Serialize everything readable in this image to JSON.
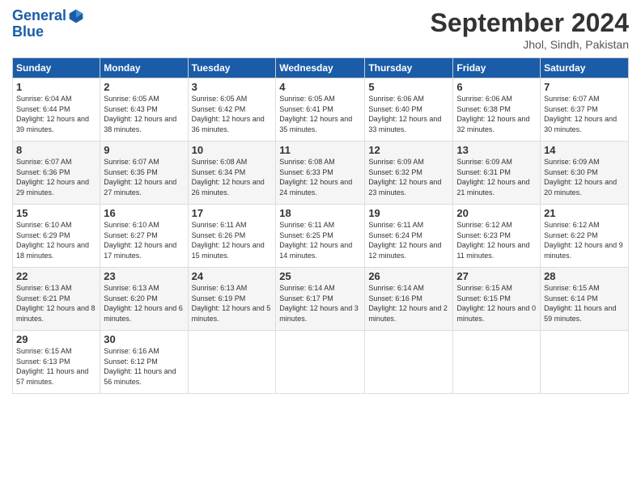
{
  "header": {
    "logo_line1": "General",
    "logo_line2": "Blue",
    "month_title": "September 2024",
    "location": "Jhol, Sindh, Pakistan"
  },
  "weekdays": [
    "Sunday",
    "Monday",
    "Tuesday",
    "Wednesday",
    "Thursday",
    "Friday",
    "Saturday"
  ],
  "weeks": [
    [
      {
        "day": "1",
        "sunrise": "6:04 AM",
        "sunset": "6:44 PM",
        "daylight": "12 hours and 39 minutes."
      },
      {
        "day": "2",
        "sunrise": "6:05 AM",
        "sunset": "6:43 PM",
        "daylight": "12 hours and 38 minutes."
      },
      {
        "day": "3",
        "sunrise": "6:05 AM",
        "sunset": "6:42 PM",
        "daylight": "12 hours and 36 minutes."
      },
      {
        "day": "4",
        "sunrise": "6:05 AM",
        "sunset": "6:41 PM",
        "daylight": "12 hours and 35 minutes."
      },
      {
        "day": "5",
        "sunrise": "6:06 AM",
        "sunset": "6:40 PM",
        "daylight": "12 hours and 33 minutes."
      },
      {
        "day": "6",
        "sunrise": "6:06 AM",
        "sunset": "6:38 PM",
        "daylight": "12 hours and 32 minutes."
      },
      {
        "day": "7",
        "sunrise": "6:07 AM",
        "sunset": "6:37 PM",
        "daylight": "12 hours and 30 minutes."
      }
    ],
    [
      {
        "day": "8",
        "sunrise": "6:07 AM",
        "sunset": "6:36 PM",
        "daylight": "12 hours and 29 minutes."
      },
      {
        "day": "9",
        "sunrise": "6:07 AM",
        "sunset": "6:35 PM",
        "daylight": "12 hours and 27 minutes."
      },
      {
        "day": "10",
        "sunrise": "6:08 AM",
        "sunset": "6:34 PM",
        "daylight": "12 hours and 26 minutes."
      },
      {
        "day": "11",
        "sunrise": "6:08 AM",
        "sunset": "6:33 PM",
        "daylight": "12 hours and 24 minutes."
      },
      {
        "day": "12",
        "sunrise": "6:09 AM",
        "sunset": "6:32 PM",
        "daylight": "12 hours and 23 minutes."
      },
      {
        "day": "13",
        "sunrise": "6:09 AM",
        "sunset": "6:31 PM",
        "daylight": "12 hours and 21 minutes."
      },
      {
        "day": "14",
        "sunrise": "6:09 AM",
        "sunset": "6:30 PM",
        "daylight": "12 hours and 20 minutes."
      }
    ],
    [
      {
        "day": "15",
        "sunrise": "6:10 AM",
        "sunset": "6:29 PM",
        "daylight": "12 hours and 18 minutes."
      },
      {
        "day": "16",
        "sunrise": "6:10 AM",
        "sunset": "6:27 PM",
        "daylight": "12 hours and 17 minutes."
      },
      {
        "day": "17",
        "sunrise": "6:11 AM",
        "sunset": "6:26 PM",
        "daylight": "12 hours and 15 minutes."
      },
      {
        "day": "18",
        "sunrise": "6:11 AM",
        "sunset": "6:25 PM",
        "daylight": "12 hours and 14 minutes."
      },
      {
        "day": "19",
        "sunrise": "6:11 AM",
        "sunset": "6:24 PM",
        "daylight": "12 hours and 12 minutes."
      },
      {
        "day": "20",
        "sunrise": "6:12 AM",
        "sunset": "6:23 PM",
        "daylight": "12 hours and 11 minutes."
      },
      {
        "day": "21",
        "sunrise": "6:12 AM",
        "sunset": "6:22 PM",
        "daylight": "12 hours and 9 minutes."
      }
    ],
    [
      {
        "day": "22",
        "sunrise": "6:13 AM",
        "sunset": "6:21 PM",
        "daylight": "12 hours and 8 minutes."
      },
      {
        "day": "23",
        "sunrise": "6:13 AM",
        "sunset": "6:20 PM",
        "daylight": "12 hours and 6 minutes."
      },
      {
        "day": "24",
        "sunrise": "6:13 AM",
        "sunset": "6:19 PM",
        "daylight": "12 hours and 5 minutes."
      },
      {
        "day": "25",
        "sunrise": "6:14 AM",
        "sunset": "6:17 PM",
        "daylight": "12 hours and 3 minutes."
      },
      {
        "day": "26",
        "sunrise": "6:14 AM",
        "sunset": "6:16 PM",
        "daylight": "12 hours and 2 minutes."
      },
      {
        "day": "27",
        "sunrise": "6:15 AM",
        "sunset": "6:15 PM",
        "daylight": "12 hours and 0 minutes."
      },
      {
        "day": "28",
        "sunrise": "6:15 AM",
        "sunset": "6:14 PM",
        "daylight": "11 hours and 59 minutes."
      }
    ],
    [
      {
        "day": "29",
        "sunrise": "6:15 AM",
        "sunset": "6:13 PM",
        "daylight": "11 hours and 57 minutes."
      },
      {
        "day": "30",
        "sunrise": "6:16 AM",
        "sunset": "6:12 PM",
        "daylight": "11 hours and 56 minutes."
      },
      null,
      null,
      null,
      null,
      null
    ]
  ]
}
